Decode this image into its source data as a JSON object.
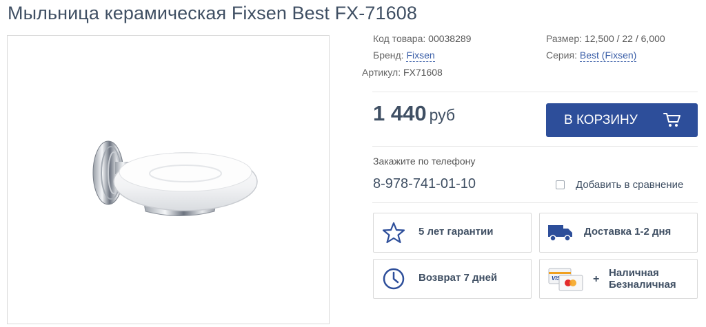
{
  "product": {
    "title": "Мыльница керамическая Fixsen Best FX-71608",
    "image_alt": "soap-dish-photo"
  },
  "info": {
    "code_label": "Код товара:",
    "code_value": "00038289",
    "size_label": "Размер:",
    "size_value": "12,500 / 22 / 6,000",
    "brand_label": "Бренд:",
    "brand_value": "Fixsen",
    "series_label": "Серия:",
    "series_value": "Best (Fixsen)",
    "article_label": "Артикул:",
    "article_value": "FX71608"
  },
  "price": {
    "amount": "1 440",
    "currency": "руб"
  },
  "cart": {
    "label": "В КОРЗИНУ",
    "icon": "cart-icon",
    "color": "#2d4e9a"
  },
  "order": {
    "phone_label": "Закажите по телефону",
    "phone": "8-978-741-01-10",
    "compare_label": "Добавить в сравнение"
  },
  "features": {
    "warranty": {
      "label": "5 лет гарантии",
      "icon": "star-icon"
    },
    "delivery": {
      "label": "Доставка 1-2 дня",
      "icon": "truck-icon"
    },
    "returns": {
      "label": "Возврат 7 дней",
      "icon": "clock-icon"
    },
    "payment": {
      "line1": "Наличная",
      "line2": "Безналичная",
      "plus": "+",
      "icon": "payment-cards-icon",
      "visa_text": "VISA"
    }
  },
  "colors": {
    "accent": "#2d4e9a",
    "text_dark": "#3f4f63",
    "link": "#3b5fa8"
  }
}
